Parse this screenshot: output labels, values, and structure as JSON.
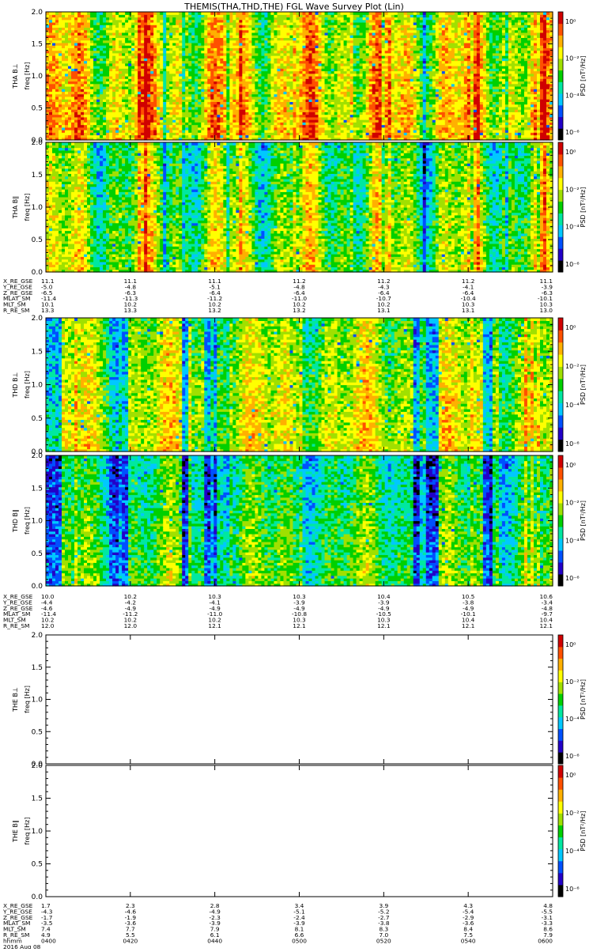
{
  "title": "THEMIS(THA,THD,THE) FGL Wave Survey Plot (Lin)",
  "colorbar": {
    "label": "PSD [nT²/Hz]",
    "tick_labels": [
      "10⁰",
      "10⁻²",
      "10⁻⁴",
      "10⁻⁶"
    ],
    "colors": [
      "#000000",
      "#2200c8",
      "#0050ff",
      "#00c8ff",
      "#00e8a0",
      "#00d000",
      "#a0e000",
      "#ffff00",
      "#ffb000",
      "#ff5000",
      "#d00000"
    ]
  },
  "chart_data": [
    {
      "type": "heatmap",
      "panel": "THA B⊥",
      "probe": "THA",
      "ylabel": [
        "THA B⊥",
        "freq [Hz]"
      ],
      "ylim": [
        0.0,
        2.0
      ],
      "yticks": [
        "0.0",
        "0.5",
        "1.0",
        "1.5",
        "2.0"
      ],
      "data_state": "filled spectrogram",
      "note_values": "colors represent log PSD; high activity bands (red/orange) prominent"
    },
    {
      "type": "heatmap",
      "panel": "THA B∥",
      "probe": "THA",
      "ylabel": [
        "THA B∥",
        "freq [Hz]"
      ],
      "ylim": [
        0.0,
        2.0
      ],
      "yticks": [
        "0.0",
        "0.5",
        "1.0",
        "1.5",
        "2.0"
      ],
      "data_state": "filled spectrogram"
    },
    {
      "type": "heatmap",
      "panel": "THD B⊥",
      "probe": "THD",
      "ylabel": [
        "THD B⊥",
        "freq [Hz]"
      ],
      "ylim": [
        0.0,
        2.0
      ],
      "yticks": [
        "0.0",
        "0.5",
        "1.0",
        "1.5",
        "2.0"
      ],
      "data_state": "filled spectrogram"
    },
    {
      "type": "heatmap",
      "panel": "THD B∥",
      "probe": "THD",
      "ylabel": [
        "THD B∥",
        "freq [Hz]"
      ],
      "ylim": [
        0.0,
        2.0
      ],
      "yticks": [
        "0.0",
        "0.5",
        "1.0",
        "1.5",
        "2.0"
      ],
      "data_state": "filled spectrogram"
    },
    {
      "type": "heatmap",
      "panel": "THE B⊥",
      "probe": "THE",
      "ylabel": [
        "THE B⊥",
        "freq [Hz]"
      ],
      "ylim": [
        0.0,
        2.0
      ],
      "yticks": [
        "0.0",
        "0.5",
        "1.0",
        "1.5",
        "2.0"
      ],
      "data_state": "empty"
    },
    {
      "type": "heatmap",
      "panel": "THE B∥",
      "probe": "THE",
      "ylabel": [
        "THE B∥",
        "freq [Hz]"
      ],
      "ylim": [
        0.0,
        2.0
      ],
      "yticks": [
        "0.0",
        "0.5",
        "1.0",
        "1.5",
        "2.0"
      ],
      "data_state": "empty"
    }
  ],
  "ephemeris": [
    {
      "probe": "THA",
      "labels": [
        "X_RE_GSE",
        "Y_RE_GSE",
        "Z_RE_GSE",
        "MLAT_SM",
        "MLT_SM",
        "R_RE_SM"
      ],
      "columns": [
        [
          "11.1",
          "-5.0",
          "-6.5",
          "-11.4",
          "10.1",
          "13.3"
        ],
        [
          "11.1",
          "-4.8",
          "-6.3",
          "-11.3",
          "10.2",
          "13.3"
        ],
        [
          "11.1",
          "-5.1",
          "-6.4",
          "-11.2",
          "10.2",
          "13.2"
        ],
        [
          "11.2",
          "-4.8",
          "-6.4",
          "-11.0",
          "10.2",
          "13.2"
        ],
        [
          "11.2",
          "-4.3",
          "-6.4",
          "-10.7",
          "10.2",
          "13.1"
        ],
        [
          "11.2",
          "-4.1",
          "-6.4",
          "-10.4",
          "10.3",
          "13.1"
        ],
        [
          "11.1",
          "-3.9",
          "-6.3",
          "-10.1",
          "10.3",
          "13.0"
        ]
      ]
    },
    {
      "probe": "THD",
      "labels": [
        "X_RE_GSE",
        "Y_RE_GSE",
        "Z_RE_GSE",
        "MLAT_SM",
        "MLT_SM",
        "R_RE_SM"
      ],
      "columns": [
        [
          "10.0",
          "-4.4",
          "-4.6",
          "-11.4",
          "10.2",
          "12.0"
        ],
        [
          "10.2",
          "-4.2",
          "-4.9",
          "-11.2",
          "10.2",
          "12.0"
        ],
        [
          "10.3",
          "-4.1",
          "-4.9",
          "-11.0",
          "10.2",
          "12.1"
        ],
        [
          "10.3",
          "-3.9",
          "-4.9",
          "-10.8",
          "10.3",
          "12.1"
        ],
        [
          "10.4",
          "-3.9",
          "-4.9",
          "-10.5",
          "10.3",
          "12.1"
        ],
        [
          "10.5",
          "-3.8",
          "-4.9",
          "-10.1",
          "10.4",
          "12.1"
        ],
        [
          "10.6",
          "-3.4",
          "-4.8",
          "-9.7",
          "10.4",
          "12.1"
        ]
      ]
    },
    {
      "probe": "THE",
      "labels": [
        "X_RE_GSE",
        "Y_RE_GSE",
        "Z_RE_GSE",
        "MLAT_SM",
        "MLT_SM",
        "R_RE_SM",
        "hhmm",
        "2016 Aug 08"
      ],
      "columns": [
        [
          "1.7",
          "-4.3",
          "-1.7",
          "-3.5",
          "7.4",
          "4.9",
          "0400"
        ],
        [
          "2.3",
          "-4.6",
          "-1.9",
          "-3.6",
          "7.7",
          "5.5",
          "0420"
        ],
        [
          "2.8",
          "-4.9",
          "-2.3",
          "-3.9",
          "7.9",
          "6.1",
          "0440"
        ],
        [
          "3.4",
          "-5.1",
          "-2.4",
          "-3.9",
          "8.1",
          "6.6",
          "0500"
        ],
        [
          "3.9",
          "-5.2",
          "-2.7",
          "-3.8",
          "8.3",
          "7.0",
          "0520"
        ],
        [
          "4.3",
          "-5.4",
          "-2.9",
          "-3.6",
          "8.4",
          "7.5",
          "0540"
        ],
        [
          "4.8",
          "-5.5",
          "-3.1",
          "-3.3",
          "8.6",
          "7.9",
          "0600"
        ]
      ]
    }
  ]
}
